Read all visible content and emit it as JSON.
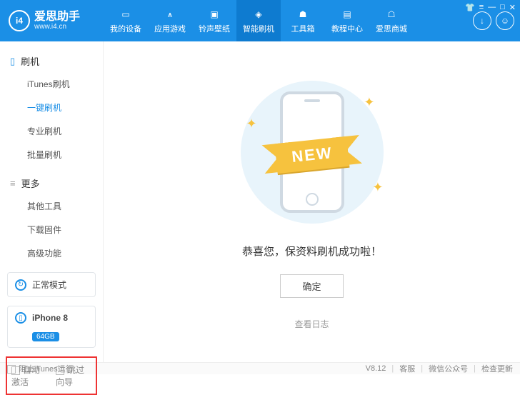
{
  "brand": {
    "name": "爱思助手",
    "url": "www.i4.cn",
    "logo_text": "i4"
  },
  "window_icons": [
    "👕",
    "≡",
    "—",
    "□",
    "✕"
  ],
  "header_right_icons": [
    "download",
    "user"
  ],
  "tabs": [
    {
      "label": "我的设备",
      "active": false
    },
    {
      "label": "应用游戏",
      "active": false
    },
    {
      "label": "铃声壁纸",
      "active": false
    },
    {
      "label": "智能刷机",
      "active": true
    },
    {
      "label": "工具箱",
      "active": false
    },
    {
      "label": "教程中心",
      "active": false
    },
    {
      "label": "爱思商城",
      "active": false
    }
  ],
  "sidebar": {
    "groups": [
      {
        "title": "刷机",
        "icon": "phone",
        "items": [
          {
            "label": "iTunes刷机",
            "active": false
          },
          {
            "label": "一键刷机",
            "active": true
          },
          {
            "label": "专业刷机",
            "active": false
          },
          {
            "label": "批量刷机",
            "active": false
          }
        ]
      },
      {
        "title": "更多",
        "icon": "more",
        "items": [
          {
            "label": "其他工具",
            "active": false
          },
          {
            "label": "下载固件",
            "active": false
          },
          {
            "label": "高级功能",
            "active": false
          }
        ]
      }
    ],
    "device_mode": "正常模式",
    "device_name": "iPhone 8",
    "device_badge": "64GB",
    "options": [
      {
        "label": "自动激活",
        "checked": false
      },
      {
        "label": "跳过向导",
        "checked": false
      }
    ]
  },
  "main": {
    "ribbon_text": "NEW",
    "message": "恭喜您，保资料刷机成功啦！",
    "ok_label": "确定",
    "log_link": "查看日志"
  },
  "footer": {
    "left_checkbox": "阻止iTunes运行",
    "version": "V8.12",
    "links": [
      "客服",
      "微信公众号",
      "检查更新"
    ]
  }
}
